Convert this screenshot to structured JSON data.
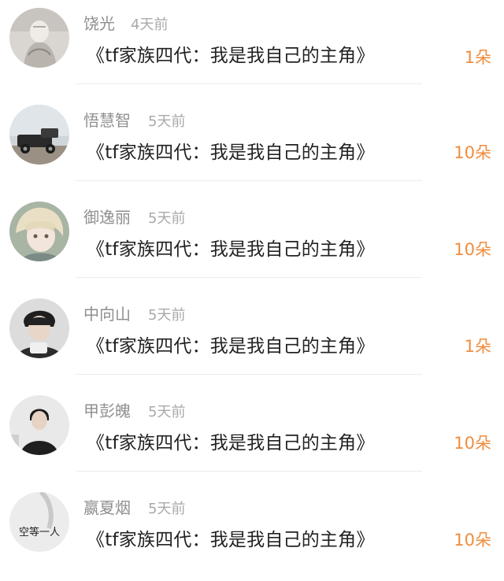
{
  "comments": [
    {
      "username": "饶光",
      "time": "4天前",
      "gift": "《tf家族四代：我是我自己的主角》",
      "count": "1朵",
      "avatar_icon": "user-avatar-sketch"
    },
    {
      "username": "悟慧智",
      "time": "5天前",
      "gift": "《tf家族四代：我是我自己的主角》",
      "count": "10朵",
      "avatar_icon": "user-avatar-vintage-car"
    },
    {
      "username": "御逸丽",
      "time": "5天前",
      "gift": "《tf家族四代：我是我自己的主角》",
      "count": "10朵",
      "avatar_icon": "user-avatar-anime"
    },
    {
      "username": "中向山",
      "time": "5天前",
      "gift": "《tf家族四代：我是我自己的主角》",
      "count": "1朵",
      "avatar_icon": "user-avatar-photo"
    },
    {
      "username": "甲彭魄",
      "time": "5天前",
      "gift": "《tf家族四代：我是我自己的主角》",
      "count": "10朵",
      "avatar_icon": "user-avatar-photo"
    },
    {
      "username": "嬴夏烟",
      "time": "5天前",
      "gift": "《tf家族四代：我是我自己的主角》",
      "count": "10朵",
      "avatar_icon": "user-avatar-text",
      "avatar_caption": "空等一人"
    }
  ],
  "colors": {
    "count_accent": "#f08c3c",
    "username": "#8f8f8f",
    "time": "#a9a9a9"
  }
}
